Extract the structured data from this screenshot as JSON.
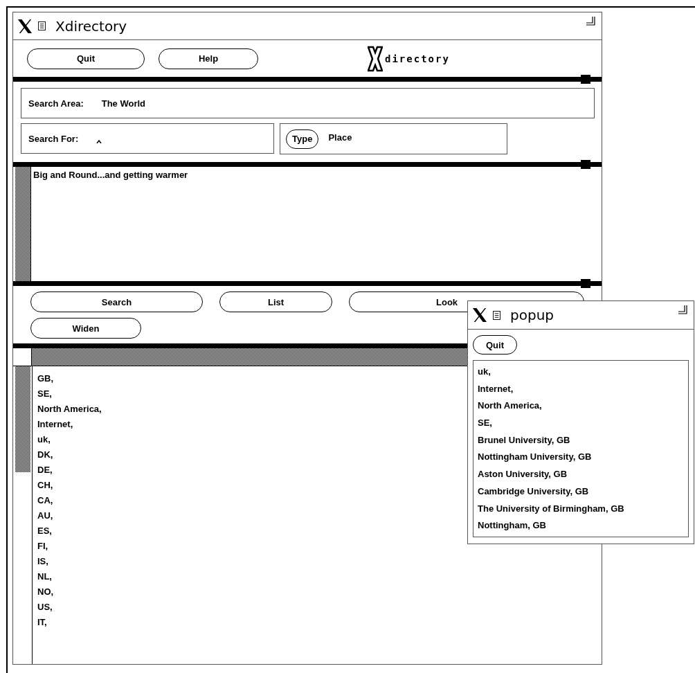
{
  "window": {
    "title": "Xdirectory"
  },
  "toolbar": {
    "buttons": [
      "Quit",
      "Help"
    ],
    "logo_text": "directory"
  },
  "search_area": {
    "label": "Search Area:",
    "value": "The World"
  },
  "search_for": {
    "label": "Search For:"
  },
  "type": {
    "button": "Type",
    "value": "Place"
  },
  "message": "Big and Round...and getting warmer",
  "actions": [
    {
      "label": "Search",
      "kind": "wide"
    },
    {
      "label": "List",
      "kind": "medium"
    },
    {
      "label": "Look",
      "kind": "long"
    },
    {
      "label": "Widen",
      "kind": "small"
    }
  ],
  "results": [
    "GB,",
    "SE,",
    "North America,",
    "Internet,",
    "uk,",
    "DK,",
    "DE,",
    "CH,",
    "CA,",
    "AU,",
    "ES,",
    "FI,",
    "IS,",
    "NL,",
    "NO,",
    "US,",
    "IT,"
  ],
  "popup": {
    "title": "popup",
    "button": "Quit",
    "items": [
      "uk,",
      "Internet,",
      "North America,",
      "SE,",
      "Brunel University, GB",
      "Nottingham University, GB",
      "Aston University, GB",
      "Cambridge University, GB",
      "The University of Birmingham, GB",
      "Nottingham, GB"
    ]
  }
}
